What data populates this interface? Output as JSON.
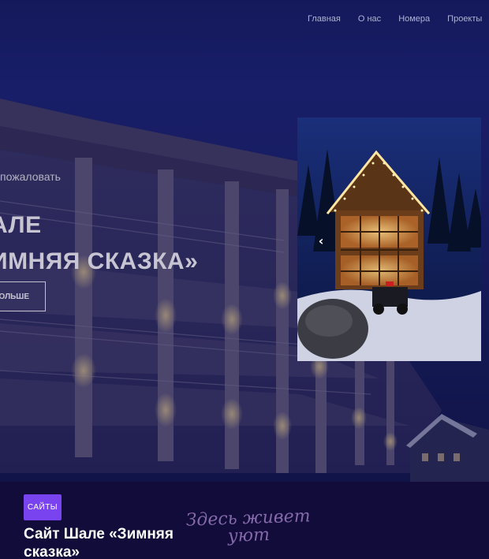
{
  "nav": {
    "items": [
      "Главная",
      "О нас",
      "Номера",
      "Проекты"
    ]
  },
  "hero": {
    "welcome": "пожаловать",
    "title_line1": "АЛЕ",
    "title_line2": "ИМНЯЯ СКАЗКА»",
    "more_button": "БОЛЬШЕ",
    "carousel_prev_icon": "chevron-left-icon"
  },
  "card": {
    "category_badge": "САЙТЫ",
    "title": "Сайт Шале «Зимняя сказка»",
    "script_line1": "Здесь живет",
    "script_line2": "уют"
  },
  "colors": {
    "footer_bg": "#120c3a",
    "badge_bg": "#7a43f0",
    "hero_bg": "#1b2170"
  }
}
